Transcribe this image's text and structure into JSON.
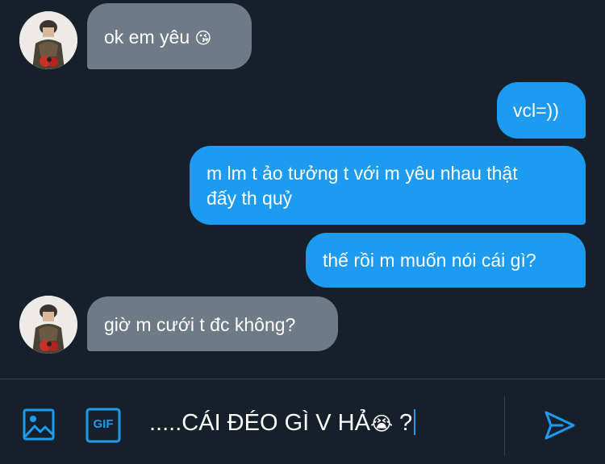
{
  "messages": [
    {
      "direction": "in",
      "text": "ok em yêu",
      "emoji": "😘"
    },
    {
      "direction": "out",
      "text": "vcl=))"
    },
    {
      "direction": "out",
      "line1": "m lm t ảo tưởng t với m yêu nhau thật",
      "line2": "đấy th quỷ"
    },
    {
      "direction": "out",
      "text": "thế rồi m muốn nói cái gì?"
    },
    {
      "direction": "in",
      "text": "giờ m cưới t đc không?"
    }
  ],
  "composer": {
    "text": ".....CÁI ĐÉO GÌ V HẢ",
    "emoji": "😭",
    "suffix": " ?",
    "gif_label": "GIF"
  },
  "icons": {
    "media": "image-icon",
    "gif": "gif-icon",
    "send": "send-icon"
  },
  "colors": {
    "background": "#15202b",
    "incoming_bubble": "#6e7a86",
    "outgoing_bubble": "#1d9bf0",
    "accent": "#1d9bf0"
  }
}
